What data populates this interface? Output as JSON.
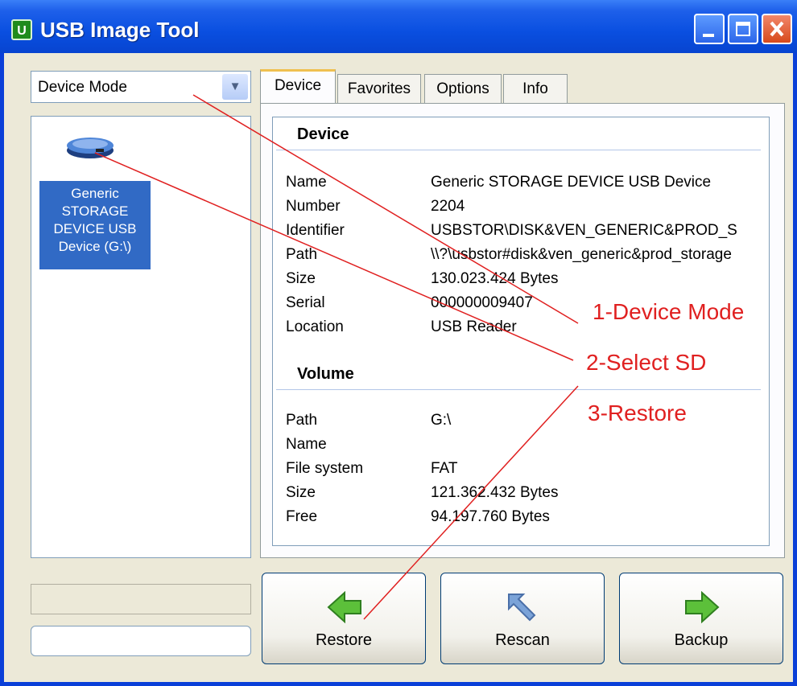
{
  "window": {
    "title": "USB Image Tool",
    "app_icon": "U"
  },
  "mode_combo": {
    "value": "Device Mode"
  },
  "device_list": {
    "items": [
      {
        "label": "Generic STORAGE DEVICE USB Device (G:\\)"
      }
    ]
  },
  "tabs": [
    "Device",
    "Favorites",
    "Options",
    "Info"
  ],
  "device_section": {
    "heading": "Device",
    "rows": [
      {
        "label": "Name",
        "value": "Generic STORAGE DEVICE USB Device"
      },
      {
        "label": "Number",
        "value": "2204"
      },
      {
        "label": "Identifier",
        "value": "USBSTOR\\DISK&VEN_GENERIC&PROD_S"
      },
      {
        "label": "Path",
        "value": "\\\\?\\usbstor#disk&ven_generic&prod_storage"
      },
      {
        "label": "Size",
        "value": "130.023.424 Bytes"
      },
      {
        "label": "Serial",
        "value": "000000009407"
      },
      {
        "label": "Location",
        "value": "USB Reader"
      }
    ]
  },
  "volume_section": {
    "heading": "Volume",
    "rows": [
      {
        "label": "Path",
        "value": "G:\\"
      },
      {
        "label": "Name",
        "value": ""
      },
      {
        "label": "File system",
        "value": "FAT"
      },
      {
        "label": "Size",
        "value": "121.362.432 Bytes"
      },
      {
        "label": "Free",
        "value": "94.197.760 Bytes"
      }
    ]
  },
  "buttons": {
    "restore": "Restore",
    "rescan": "Rescan",
    "backup": "Backup"
  },
  "annotations": [
    "1-Device Mode",
    "2-Select SD",
    "3-Restore"
  ],
  "colors": {
    "titlebar": "#0a4fe0",
    "selection": "#316ac5",
    "annotation": "#e02020",
    "face": "#ece9d8"
  }
}
